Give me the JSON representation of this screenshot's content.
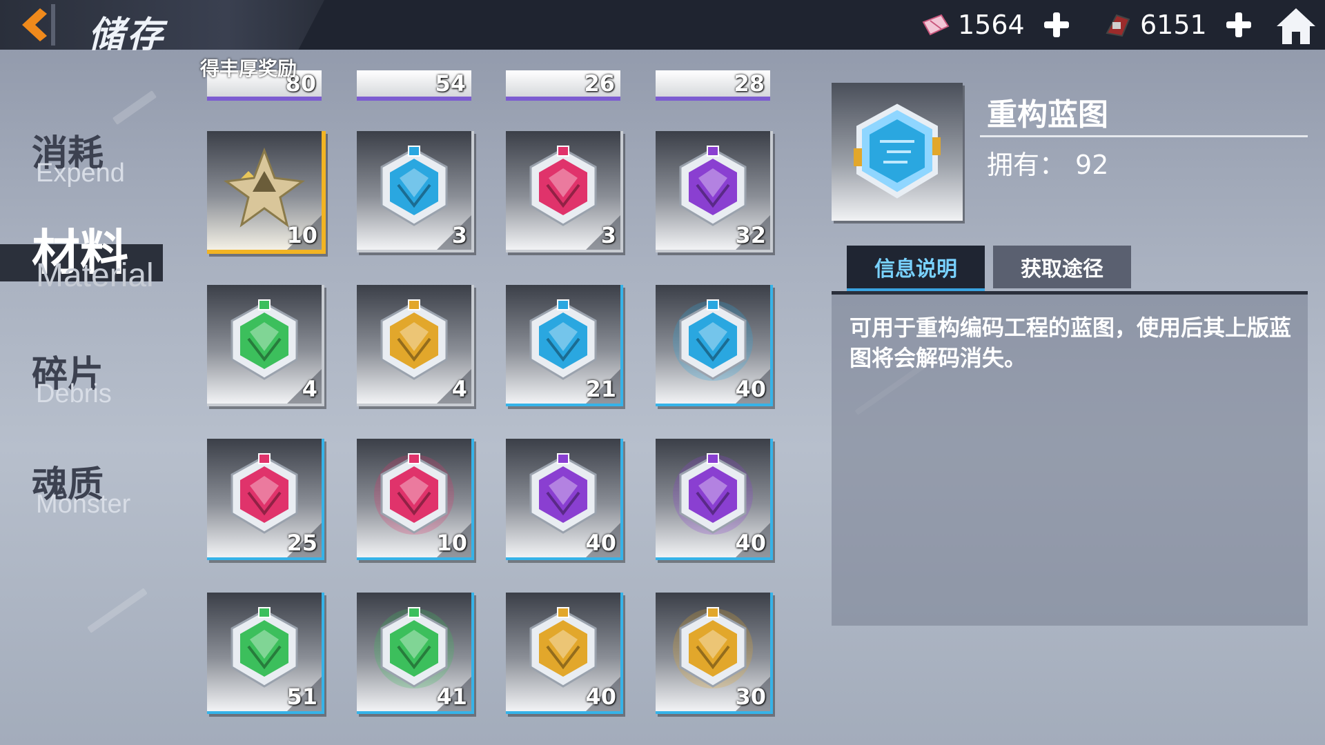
{
  "header": {
    "title": "储存",
    "currencies": [
      {
        "icon": "ticket-icon",
        "value": "1564"
      },
      {
        "icon": "chip-icon",
        "value": "6151"
      }
    ]
  },
  "sidebar": {
    "items": [
      {
        "zh": "消耗",
        "en": "Expend",
        "active": false
      },
      {
        "zh": "材料",
        "en": "Material",
        "active": true
      },
      {
        "zh": "碎片",
        "en": "Debris",
        "active": false
      },
      {
        "zh": "魂质",
        "en": "Monster",
        "active": false
      }
    ]
  },
  "grid": {
    "banner_text": "得丰厚奖励",
    "partial_row": [
      "80",
      "54",
      "26",
      "28"
    ],
    "rows": [
      [
        {
          "count": "10",
          "color": "gold",
          "frame": "gold",
          "shape": "star-cluster"
        },
        {
          "count": "3",
          "color": "#2aa7e0",
          "frame": "grey",
          "shape": "hex"
        },
        {
          "count": "3",
          "color": "#e0336b",
          "frame": "grey",
          "shape": "hex"
        },
        {
          "count": "32",
          "color": "#8a3fd1",
          "frame": "grey",
          "shape": "hex"
        }
      ],
      [
        {
          "count": "4",
          "color": "#3cbf5c",
          "frame": "grey",
          "shape": "hex"
        },
        {
          "count": "4",
          "color": "#e2a72b",
          "frame": "grey",
          "shape": "hex"
        },
        {
          "count": "21",
          "color": "#2aa7e0",
          "frame": "blue",
          "shape": "hex"
        },
        {
          "count": "40",
          "color": "#2aa7e0",
          "frame": "blue",
          "shape": "hex-glow"
        }
      ],
      [
        {
          "count": "25",
          "color": "#e0336b",
          "frame": "blue",
          "shape": "hex"
        },
        {
          "count": "10",
          "color": "#e0336b",
          "frame": "blue",
          "shape": "hex-glow"
        },
        {
          "count": "40",
          "color": "#8a3fd1",
          "frame": "blue",
          "shape": "hex"
        },
        {
          "count": "40",
          "color": "#8a3fd1",
          "frame": "blue",
          "shape": "hex-glow"
        }
      ],
      [
        {
          "count": "51",
          "color": "#3cbf5c",
          "frame": "blue",
          "shape": "hex"
        },
        {
          "count": "41",
          "color": "#3cbf5c",
          "frame": "blue",
          "shape": "hex-glow"
        },
        {
          "count": "40",
          "color": "#e2a72b",
          "frame": "blue",
          "shape": "hex"
        },
        {
          "count": "30",
          "color": "#e2a72b",
          "frame": "blue",
          "shape": "hex-glow"
        }
      ]
    ]
  },
  "detail": {
    "name": "重构蓝图",
    "own_label": "拥有：",
    "own_value": "92",
    "tabs": [
      "信息说明",
      "获取途径"
    ],
    "description": "可用于重构编码工程的蓝图，使用后其上版蓝图将会解码消失。"
  },
  "colors": {
    "accent_orange": "#f08a1c",
    "active_tab_text": "#79d2ff",
    "blue_frame": "#36b3e8",
    "gold_frame": "#f2b423"
  }
}
